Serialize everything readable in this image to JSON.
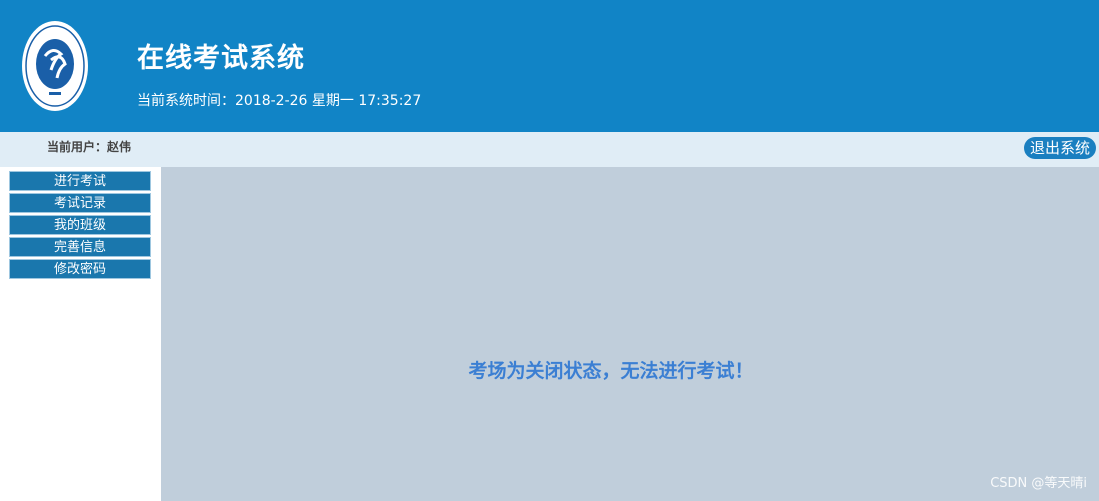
{
  "header": {
    "title": "在线考试系统",
    "clock_label": "当前系统时间：",
    "clock_value": "2018-2-26 星期一 17:35:27",
    "logo_icon": "university-seal-logo"
  },
  "userbar": {
    "user_label": "当前用户：赵伟",
    "logout_label": "退出系统"
  },
  "sidebar": {
    "items": [
      {
        "label": "进行考试"
      },
      {
        "label": "考试记录"
      },
      {
        "label": "我的班级"
      },
      {
        "label": "完善信息"
      },
      {
        "label": "修改密码"
      }
    ]
  },
  "main": {
    "notice": "考场为关闭状态，无法进行考试！"
  },
  "watermark": "CSDN @等天晴i",
  "colors": {
    "header_bg": "#1184c6",
    "userbar_bg": "#e0edf6",
    "menu_bg": "#1a77ad",
    "content_bg": "#c0cedb",
    "notice_text": "#3b7fd3"
  }
}
